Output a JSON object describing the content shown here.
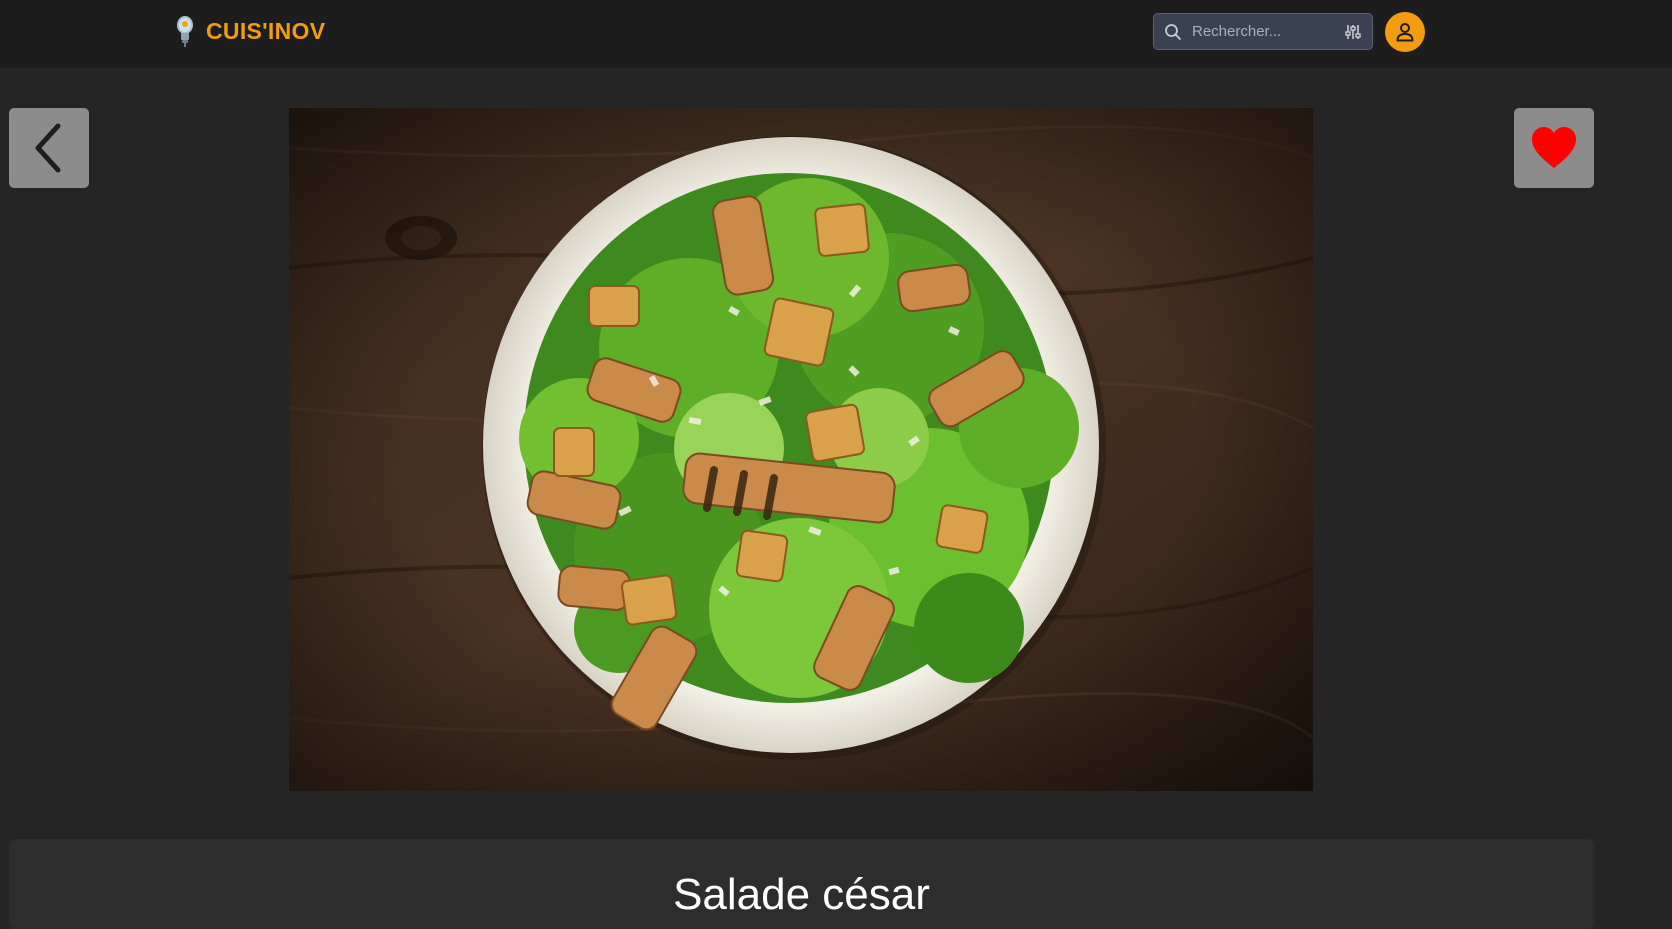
{
  "header": {
    "brand": "CUIS'INOV",
    "brand_color": "#f39c12",
    "logo_icon": "lightbulb-icon",
    "search": {
      "placeholder": "Rechercher...",
      "value": "",
      "icon": "search-icon",
      "filter_icon": "sliders-icon"
    },
    "user_icon": "user-icon"
  },
  "navigation": {
    "back_icon": "chevron-left-icon",
    "favorite_icon": "heart-icon",
    "favorite_color": "#ff0000"
  },
  "recipe": {
    "title": "Salade césar"
  }
}
